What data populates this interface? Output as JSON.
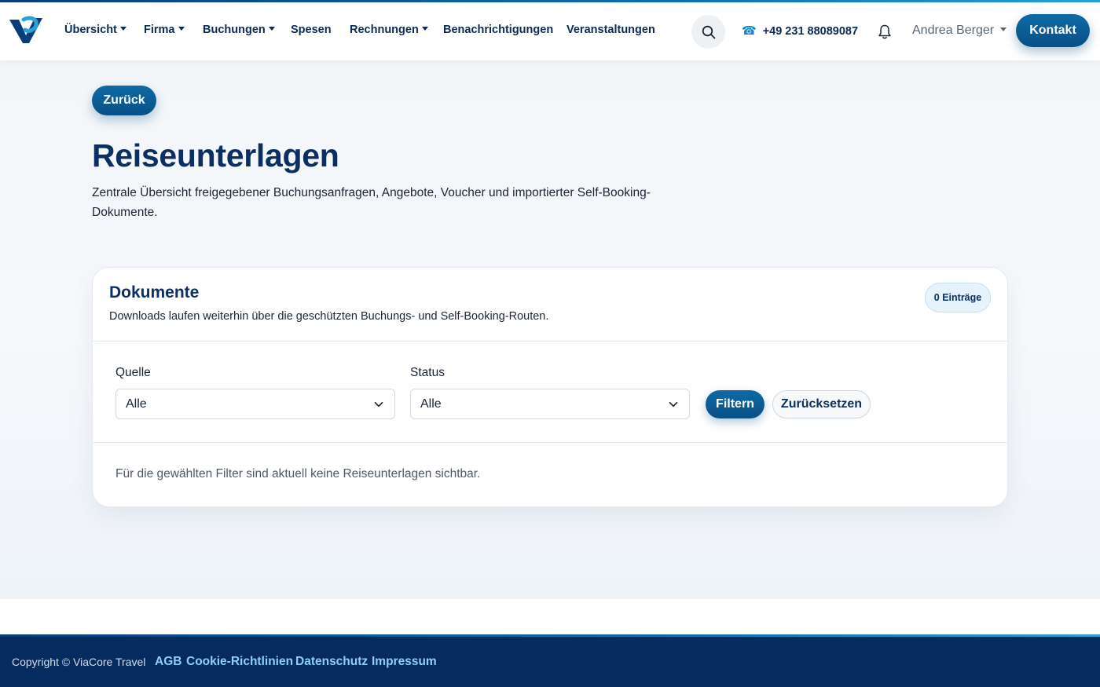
{
  "nav": {
    "items": [
      {
        "label": "Übersicht",
        "dropdown": true
      },
      {
        "label": "Firma",
        "dropdown": true
      },
      {
        "label": "Buchungen",
        "dropdown": true
      },
      {
        "label": "Spesen",
        "dropdown": false
      },
      {
        "label": "Rechnungen",
        "dropdown": true
      },
      {
        "label": "Benachrichtigungen",
        "dropdown": false
      },
      {
        "label": "Veranstaltungen",
        "dropdown": false
      }
    ],
    "phone": "+49 231 88089087",
    "user_name": "Andrea Berger",
    "contact_label": "Kontakt"
  },
  "main": {
    "back_label": "Zurück",
    "title": "Reiseunterlagen",
    "description": "Zentrale Übersicht freigegebener Buchungsanfragen, Angebote, Voucher und importierter Self-Booking-Dokumente."
  },
  "card": {
    "title": "Dokumente",
    "subtitle": "Downloads laufen weiterhin über die geschützten Buchungs- und Self-Booking-Routen.",
    "badge": "0 Einträge",
    "filters": {
      "source_label": "Quelle",
      "source_value": "Alle",
      "status_label": "Status",
      "status_value": "Alle",
      "filter_label": "Filtern",
      "reset_label": "Zurücksetzen"
    },
    "empty_message": "Für die gewählten Filter sind aktuell keine Reiseunterlagen sichtbar."
  },
  "footer": {
    "copyright": "Copyright © ViaCore Travel",
    "links": [
      "AGB",
      "Cookie-Richtlinien",
      "Datenschutz",
      "Impressum"
    ]
  },
  "colors": {
    "brand_dark": "#0c2f63",
    "brand_primary": "#0a4f86",
    "accent": "#1386c4",
    "footer_bg": "#062b5e",
    "footer_link": "#8dd0f3"
  },
  "icons": {
    "logo": "viacore-logo-icon",
    "search": "search-icon",
    "phone": "phone-icon",
    "notifications": "bell-icon",
    "select": "chevron-down-icon"
  }
}
